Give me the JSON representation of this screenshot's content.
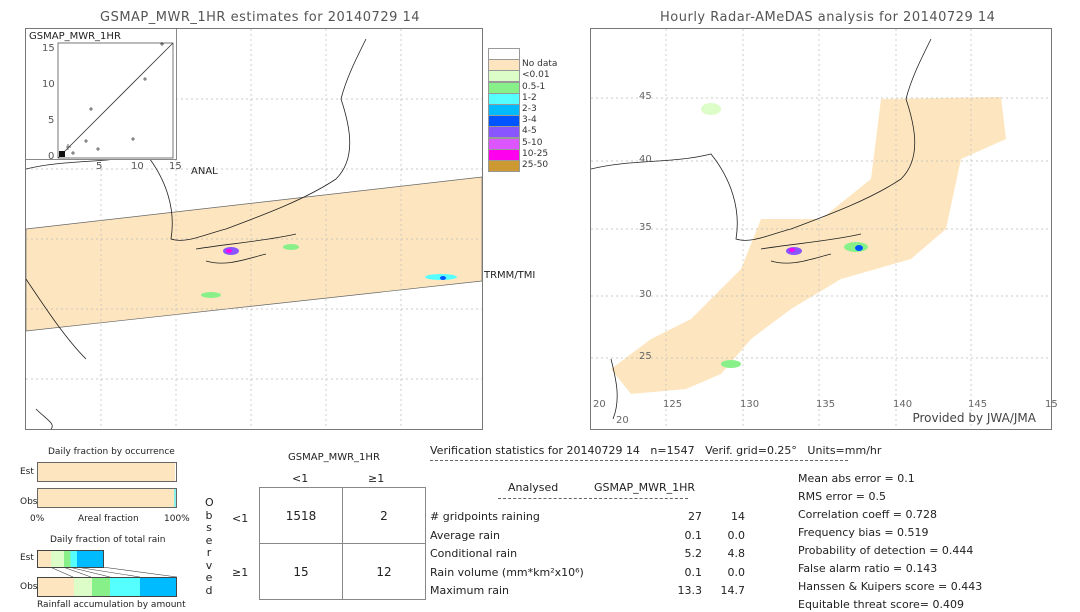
{
  "left_panel": {
    "title": "GSMAP_MWR_1HR estimates for 20140729 14",
    "inset_ylabel": "GSMAP_MWR_1HR",
    "inset_xlabel": "ANAL",
    "inset_ticks": [
      "0",
      "5",
      "10",
      "15"
    ],
    "swath_label": "TRMM/TMI"
  },
  "right_panel": {
    "title": "Hourly Radar-AMeDAS analysis for 20140729 14",
    "lat_ticks": [
      "45",
      "40",
      "35",
      "30",
      "25",
      "20"
    ],
    "lon_ticks": [
      "125",
      "130",
      "135",
      "140",
      "145",
      "15"
    ],
    "bottom_lat": "20",
    "credit": "Provided by JWA/JMA"
  },
  "legend": [
    {
      "label": "",
      "color": "#ffffff"
    },
    {
      "label": "No data",
      "color": "#fde6bf"
    },
    {
      "label": "<0.01",
      "color": "#dcfcc8"
    },
    {
      "label": "0.5-1",
      "color": "#88f088"
    },
    {
      "label": "1-2",
      "color": "#55ffff"
    },
    {
      "label": "2-3",
      "color": "#00bbff"
    },
    {
      "label": "3-4",
      "color": "#0055ff"
    },
    {
      "label": "4-5",
      "color": "#8855ff"
    },
    {
      "label": "5-10",
      "color": "#dd55ff"
    },
    {
      "label": "10-25",
      "color": "#ff00ee"
    },
    {
      "label": "25-50",
      "color": "#cc9933"
    }
  ],
  "occurrence": {
    "title": "Daily fraction by occurrence",
    "est": "Est",
    "obs": "Obs",
    "x0": "0%",
    "xlabel": "Areal fraction",
    "x1": "100%",
    "est_fraction": 0.99,
    "obs_fraction": 0.983
  },
  "total_rain": {
    "title": "Daily fraction of total rain",
    "est": "Est",
    "obs": "Obs",
    "xlabel": "Rainfall accumulation by amount"
  },
  "contingency": {
    "title": "GSMAP_MWR_1HR",
    "col_headers": [
      "<1",
      "≥1"
    ],
    "row_label": "Observed",
    "row_headers": [
      "<1",
      "≥1"
    ],
    "cells": [
      [
        "1518",
        "2"
      ],
      [
        "15",
        "12"
      ]
    ]
  },
  "stats": {
    "header": "Verification statistics for 20140729 14   n=1547   Verif. grid=0.25°   Units=mm/hr",
    "col_analysed": "Analysed",
    "col_est": "GSMAP_MWR_1HR",
    "rows": [
      {
        "label": "# gridpoints raining",
        "a": "27",
        "e": "14"
      },
      {
        "label": "Average rain",
        "a": "0.1",
        "e": "0.0"
      },
      {
        "label": "Conditional rain",
        "a": "5.2",
        "e": "4.8"
      },
      {
        "label": "Rain volume (mm*km²x10⁶)",
        "a": "0.1",
        "e": "0.0"
      },
      {
        "label": "Maximum rain",
        "a": "13.3",
        "e": "14.7"
      }
    ],
    "scores": [
      "Mean abs error = 0.1",
      "RMS error = 0.5",
      "Correlation coeff = 0.728",
      "Frequency bias = 0.519",
      "Probability of detection = 0.444",
      "False alarm ratio = 0.143",
      "Hanssen & Kuipers score = 0.443",
      "Equitable threat score= 0.409"
    ]
  }
}
